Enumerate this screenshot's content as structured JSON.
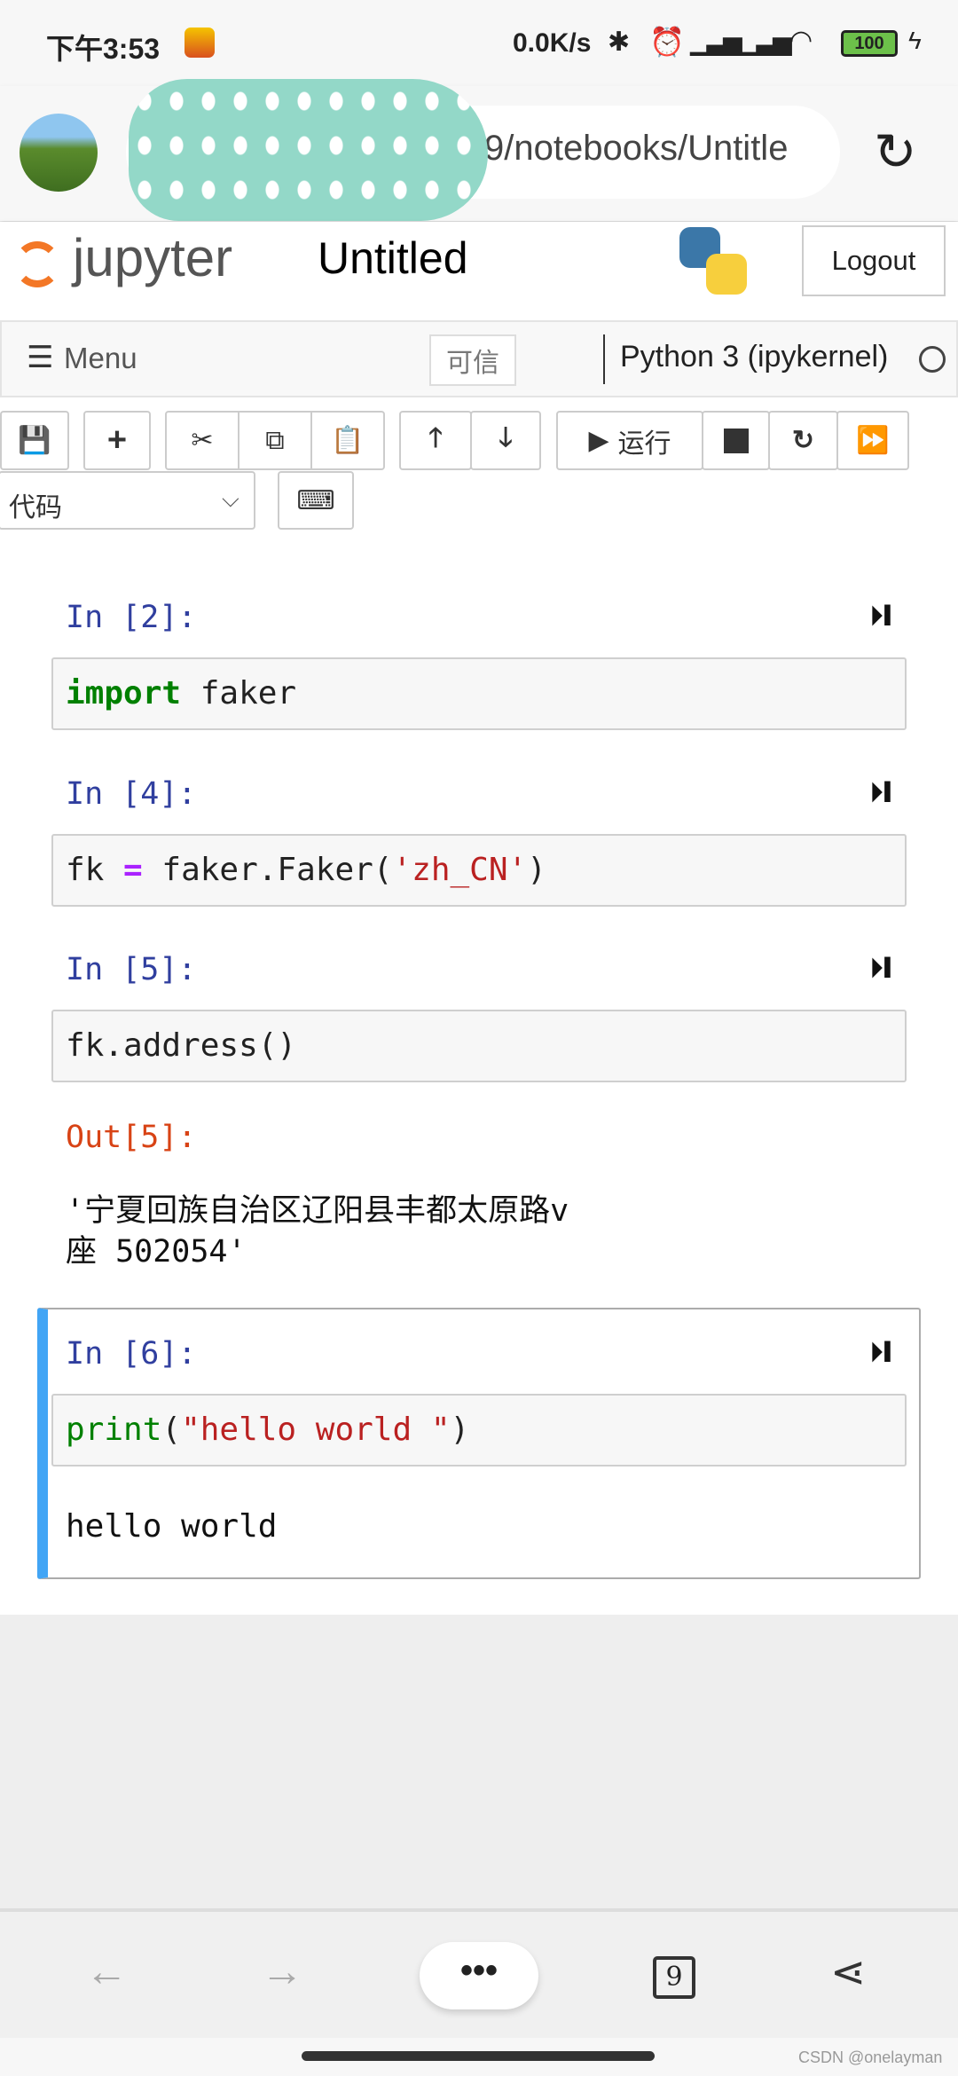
{
  "status_bar": {
    "time": "下午3:53",
    "net_speed": "0.0K/s",
    "battery": "100",
    "app_icon": "sohu-icon"
  },
  "browser": {
    "url": "9/notebooks/Untitle",
    "reload_icon": "reload-icon"
  },
  "jupyter": {
    "logo": "jupyter",
    "title": "Untitled",
    "logout": "Logout",
    "menu": "Menu",
    "trusted": "可信",
    "kernel": "Python 3 (ipykernel)"
  },
  "toolbar": {
    "run": "运行",
    "cell_type": "代码"
  },
  "cells": [
    {
      "prompt": "In [2]:",
      "code": [
        {
          "t": "import",
          "c": "#008000",
          "b": true
        },
        {
          "t": " faker",
          "c": "#222"
        }
      ]
    },
    {
      "prompt": "In [4]:",
      "code": [
        {
          "t": "fk ",
          "c": "#222"
        },
        {
          "t": "=",
          "c": "#aa22ff",
          "b": true
        },
        {
          "t": " faker.Faker(",
          "c": "#222"
        },
        {
          "t": "'zh_CN'",
          "c": "#ba2121"
        },
        {
          "t": ")",
          "c": "#222"
        }
      ]
    },
    {
      "prompt": "In [5]:",
      "code": [
        {
          "t": "fk.address()",
          "c": "#222"
        }
      ]
    },
    {
      "prompt": "In [6]:",
      "code": [
        {
          "t": "print",
          "c": "#008000"
        },
        {
          "t": "(",
          "c": "#222"
        },
        {
          "t": "\"hello world \"",
          "c": "#ba2121"
        },
        {
          "t": ")",
          "c": "#222"
        }
      ]
    }
  ],
  "out5": {
    "prompt": "Out[5]:",
    "line1": "'宁夏回族自治区辽阳县丰都太原路v",
    "line2": "座 502054'"
  },
  "out6": {
    "text": "hello world"
  },
  "bottom_nav": {
    "tabs_count": "9"
  },
  "watermark": "CSDN @onelayman",
  "colors": {
    "prompt_in": "#303f9f",
    "prompt_out": "#d84315",
    "selected_bar": "#42a5f5"
  }
}
